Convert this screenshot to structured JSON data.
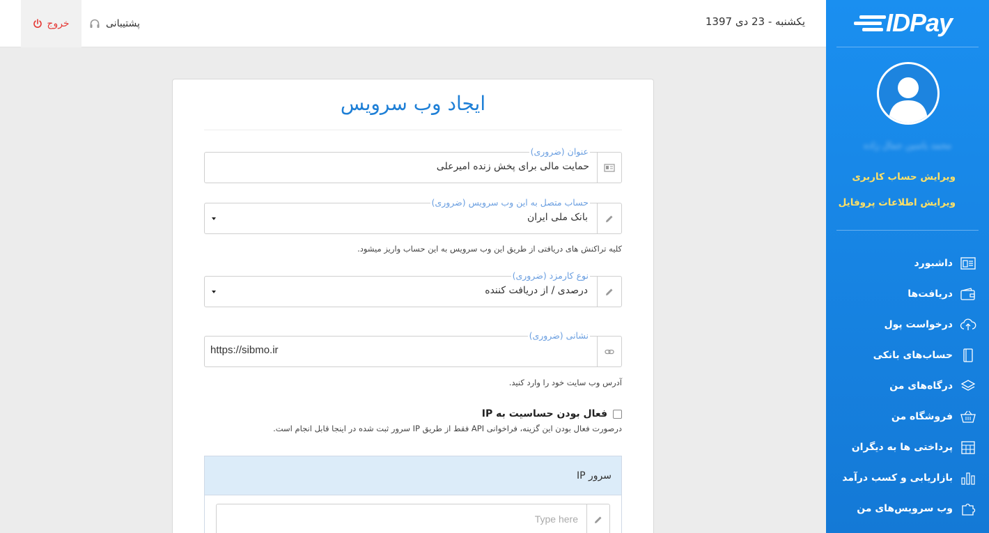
{
  "header": {
    "logout_label": "خروج",
    "support_label": "پشتیبانی",
    "date": "یکشنبه - 23 دی 1397"
  },
  "sidebar": {
    "logo": "IDPay",
    "username": "محمد یاسین جمال زاده",
    "edit_account": "ویرایش حساب کاربری",
    "edit_profile": "ویرایش اطلاعات پروفایل",
    "menu": [
      {
        "label": "داشبورد",
        "icon": "dashboard-icon"
      },
      {
        "label": "دریافت‌ها",
        "icon": "wallet-icon"
      },
      {
        "label": "درخواست پول",
        "icon": "cloud-upload-icon"
      },
      {
        "label": "حساب‌های بانکی",
        "icon": "book-icon"
      },
      {
        "label": "درگاه‌های من",
        "icon": "layers-icon"
      },
      {
        "label": "فروشگاه من",
        "icon": "basket-icon"
      },
      {
        "label": "پرداختی ها به دیگران",
        "icon": "calendar-icon"
      },
      {
        "label": "بازاریابی و کسب درآمد",
        "icon": "bar-chart-icon"
      },
      {
        "label": "وب سرویس‌های من",
        "icon": "puzzle-icon"
      }
    ]
  },
  "form": {
    "title": "ایجاد وب سرویس",
    "title_field": {
      "label": "عنوان (ضروری)",
      "value": "حمایت مالی برای پخش زنده امیرعلی"
    },
    "account_field": {
      "label": "حساب متصل به این وب سرویس (ضروری)",
      "value": "بانک ملی ایران"
    },
    "account_help": "کلیه تراکنش های دریافتی از طریق این وب سرویس به این حساب واریز میشود.",
    "fee_field": {
      "label": "نوع کارمزد (ضروری)",
      "value": "درصدی / از دریافت کننده"
    },
    "url_field": {
      "label": "نشانی (ضروری)",
      "value": "https://sibmo.ir"
    },
    "url_help": "آدرس وب سایت خود را وارد کنید.",
    "ip_checkbox_label": "فعال بودن حساسیت به IP",
    "ip_checkbox_help": "درصورت فعال بودن این گزینه، فراخوانی API فقط از طریق IP سرور ثبت شده در اینجا قابل انجام است.",
    "ip_panel_title": "IP سرور",
    "ip_placeholder": "Type here"
  },
  "colors": {
    "sidebar": "#1a8ff0",
    "accent": "#1e7fd6",
    "logout": "#e53935",
    "link": "#ffe066"
  }
}
